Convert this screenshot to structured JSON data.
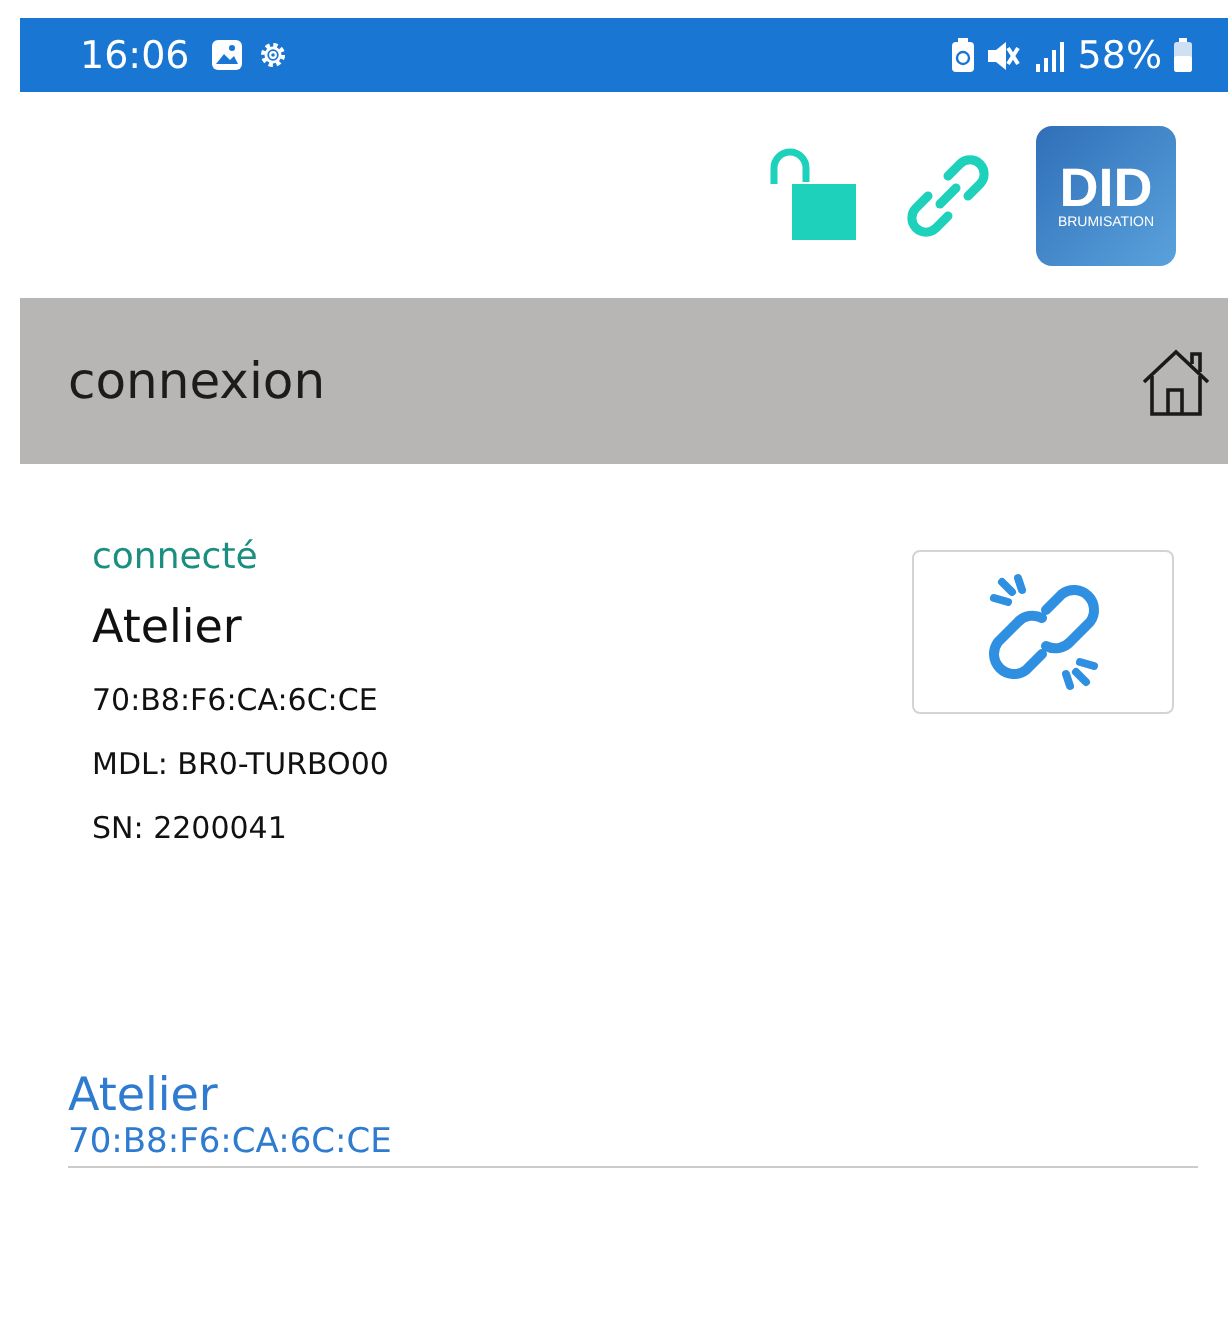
{
  "status_bar": {
    "time": "16:06",
    "battery": "58%"
  },
  "logo": {
    "title": "DID",
    "subtitle": "BRUMISATION"
  },
  "header": {
    "title": "connexion"
  },
  "device": {
    "status": "connecté",
    "name": "Atelier",
    "address": "70:B8:F6:CA:6C:CE",
    "model": "MDL: BR0-TURBO00",
    "serial": "SN: 2200041"
  },
  "devices": [
    {
      "name": "Atelier",
      "address": "70:B8:F6:CA:6C:CE"
    }
  ]
}
